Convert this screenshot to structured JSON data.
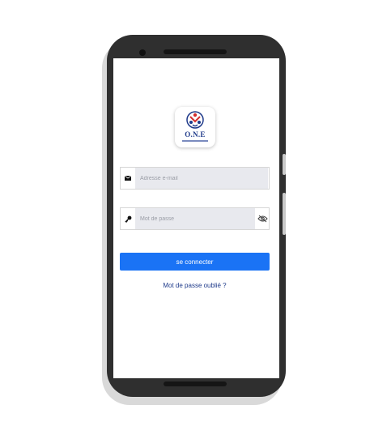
{
  "app": {
    "logo_text": "O.N.E",
    "colors": {
      "accent": "#1a73f5",
      "link": "#1e3a8a",
      "field_bg": "#e8e9ee"
    }
  },
  "login": {
    "email_placeholder": "Adresse e-mail",
    "password_placeholder": "Mot de passe",
    "submit_label": "se connecter",
    "forgot_label": "Mot de passe oublié ?"
  },
  "icons": {
    "email": "envelope-icon",
    "password": "key-icon",
    "toggle": "eye-off-icon"
  }
}
